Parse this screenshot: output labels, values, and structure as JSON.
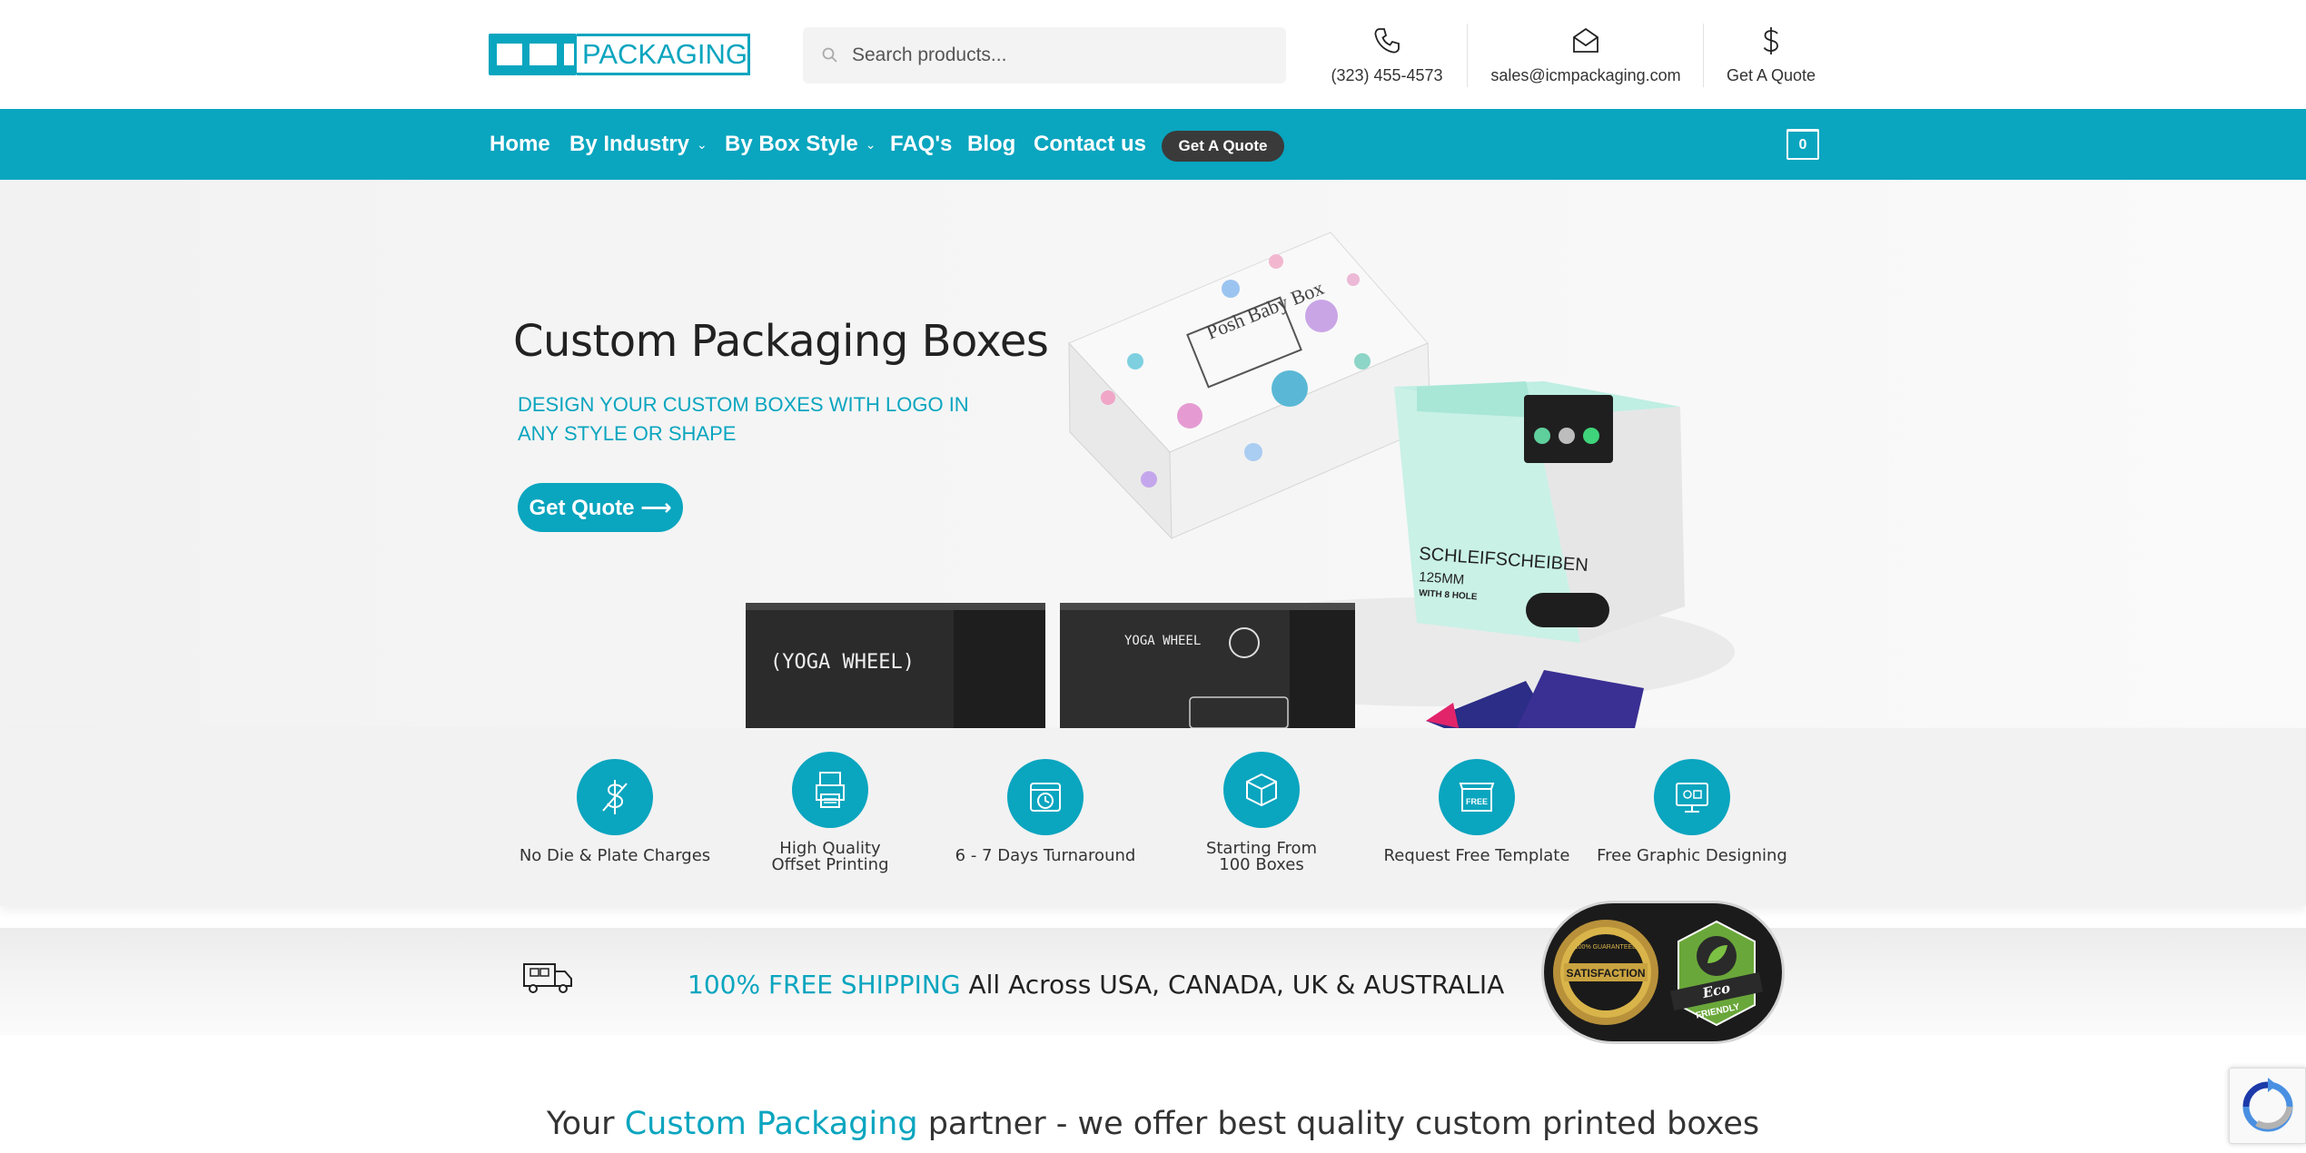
{
  "header": {
    "logo_text": "PACKAGING",
    "search_placeholder": "Search products...",
    "phone": "(323) 455-4573",
    "email": "sales@icmpackaging.com",
    "quote": "Get A Quote"
  },
  "nav": {
    "items": [
      {
        "label": "Home",
        "has_dropdown": false
      },
      {
        "label": "By Industry",
        "has_dropdown": true
      },
      {
        "label": "By Box Style",
        "has_dropdown": true
      },
      {
        "label": "FAQ's",
        "has_dropdown": false
      },
      {
        "label": "Blog",
        "has_dropdown": false
      },
      {
        "label": "Contact us",
        "has_dropdown": false
      }
    ],
    "quote_button": "Get A Quote",
    "cart_count": "0"
  },
  "hero": {
    "title": "Custom Packaging Boxes",
    "subtitle": "DESIGN YOUR CUSTOM BOXES WITH LOGO IN ANY STYLE OR SHAPE",
    "cta": "Get Quote ⟶",
    "box_texts": {
      "baby_box": "Posh Baby Box",
      "schleif_title": "SCHLEIFSCHEIBEN",
      "schleif_size": "125MM",
      "schleif_hole": "WITH 8 HOLE",
      "yoga_wheel": "(YOGA  WHEEL)",
      "yoga_wheel_2": "YOGA WHEEL"
    }
  },
  "features": [
    {
      "label": "No Die & Plate Charges",
      "icon": "dollar-slash-icon"
    },
    {
      "label": "High Quality\nOffset Printing",
      "icon": "printer-icon"
    },
    {
      "label": "6 - 7 Days Turnaround",
      "icon": "calendar-clock-icon"
    },
    {
      "label": "Starting From\n100 Boxes",
      "icon": "box-icon"
    },
    {
      "label": "Request Free Template",
      "icon": "free-box-icon"
    },
    {
      "label": "Free Graphic Designing",
      "icon": "monitor-design-icon"
    }
  ],
  "shipping": {
    "highlight": "100% FREE SHIPPING",
    "rest": " All Across USA, CANADA, UK & AUSTRALIA",
    "badge_satisfaction": "SATISFACTION",
    "badge_guarantee": "100% GUARANTEED",
    "badge_eco": "Eco",
    "badge_friendly": "FRIENDLY"
  },
  "tagline": {
    "before": "Your ",
    "highlight": "Custom Packaging",
    "after": " partner - we offer best quality custom printed boxes"
  },
  "colors": {
    "brand": "#0aa5bf",
    "dark_button": "#3a3a3a"
  }
}
